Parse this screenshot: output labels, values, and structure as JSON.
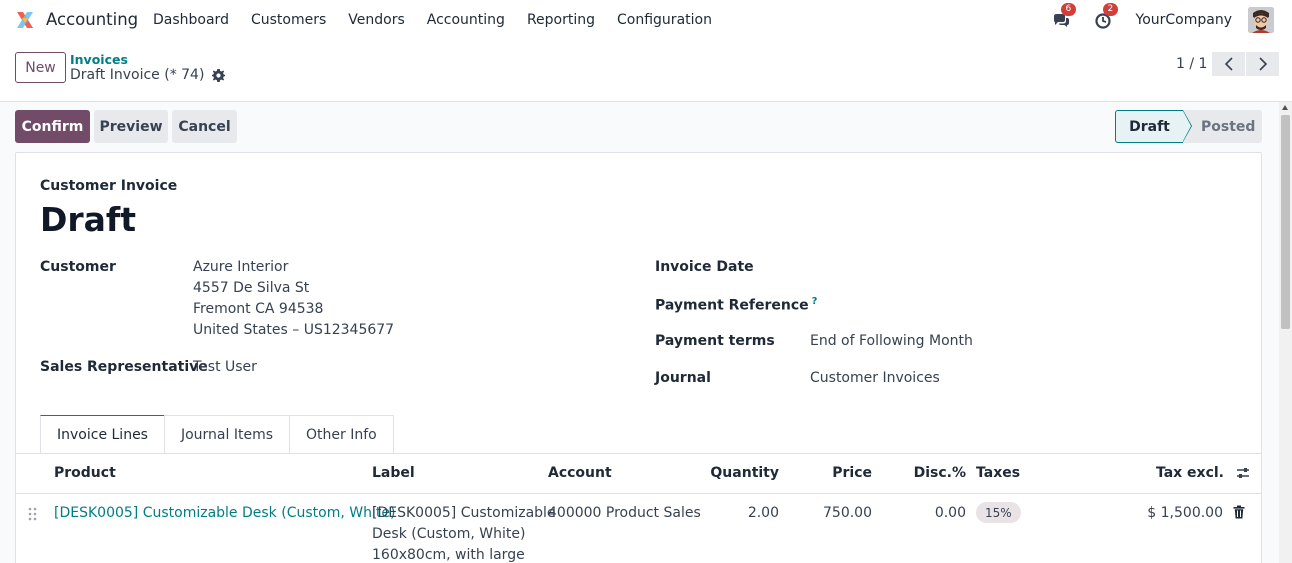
{
  "navbar": {
    "app_name": "Accounting",
    "menu": [
      "Dashboard",
      "Customers",
      "Vendors",
      "Accounting",
      "Reporting",
      "Configuration"
    ],
    "messages_count": "6",
    "activities_count": "2",
    "company": "YourCompany"
  },
  "control": {
    "new_label": "New",
    "breadcrumb_parent": "Invoices",
    "breadcrumb_current": "Draft Invoice (* 74)",
    "pager": "1 / 1"
  },
  "actions": {
    "confirm": "Confirm",
    "preview": "Preview",
    "cancel": "Cancel"
  },
  "status": {
    "draft": "Draft",
    "posted": "Posted"
  },
  "form": {
    "doc_type": "Customer Invoice",
    "doc_name": "Draft",
    "customer_label": "Customer",
    "customer_lines": [
      "Azure Interior",
      "4557 De Silva St",
      "Fremont CA 94538",
      "United States – US12345677"
    ],
    "salesrep_label": "Sales Representative",
    "salesrep_value": "Test User",
    "invoice_date_label": "Invoice Date",
    "payment_ref_label": "Payment Reference",
    "payment_ref_help": "?",
    "payment_terms_label": "Payment terms",
    "payment_terms_value": "End of Following Month",
    "journal_label": "Journal",
    "journal_value": "Customer Invoices"
  },
  "tabs": [
    "Invoice Lines",
    "Journal Items",
    "Other Info"
  ],
  "table": {
    "headers": {
      "product": "Product",
      "label": "Label",
      "account": "Account",
      "quantity": "Quantity",
      "price": "Price",
      "disc": "Disc.%",
      "taxes": "Taxes",
      "tax_excl": "Tax excl."
    },
    "rows": [
      {
        "product": "[DESK0005] Customizable Desk (Custom, White)",
        "label_lines": [
          "[DESK0005] Customizable",
          "Desk (Custom, White)",
          "160x80cm, with large"
        ],
        "account": "400000 Product Sales",
        "quantity": "2.00",
        "price": "750.00",
        "disc": "0.00",
        "tax": "15%",
        "subtotal": "$ 1,500.00"
      }
    ]
  },
  "colors": {
    "primary": "#714b67",
    "link": "#017e84",
    "badge": "#d23f3a"
  }
}
